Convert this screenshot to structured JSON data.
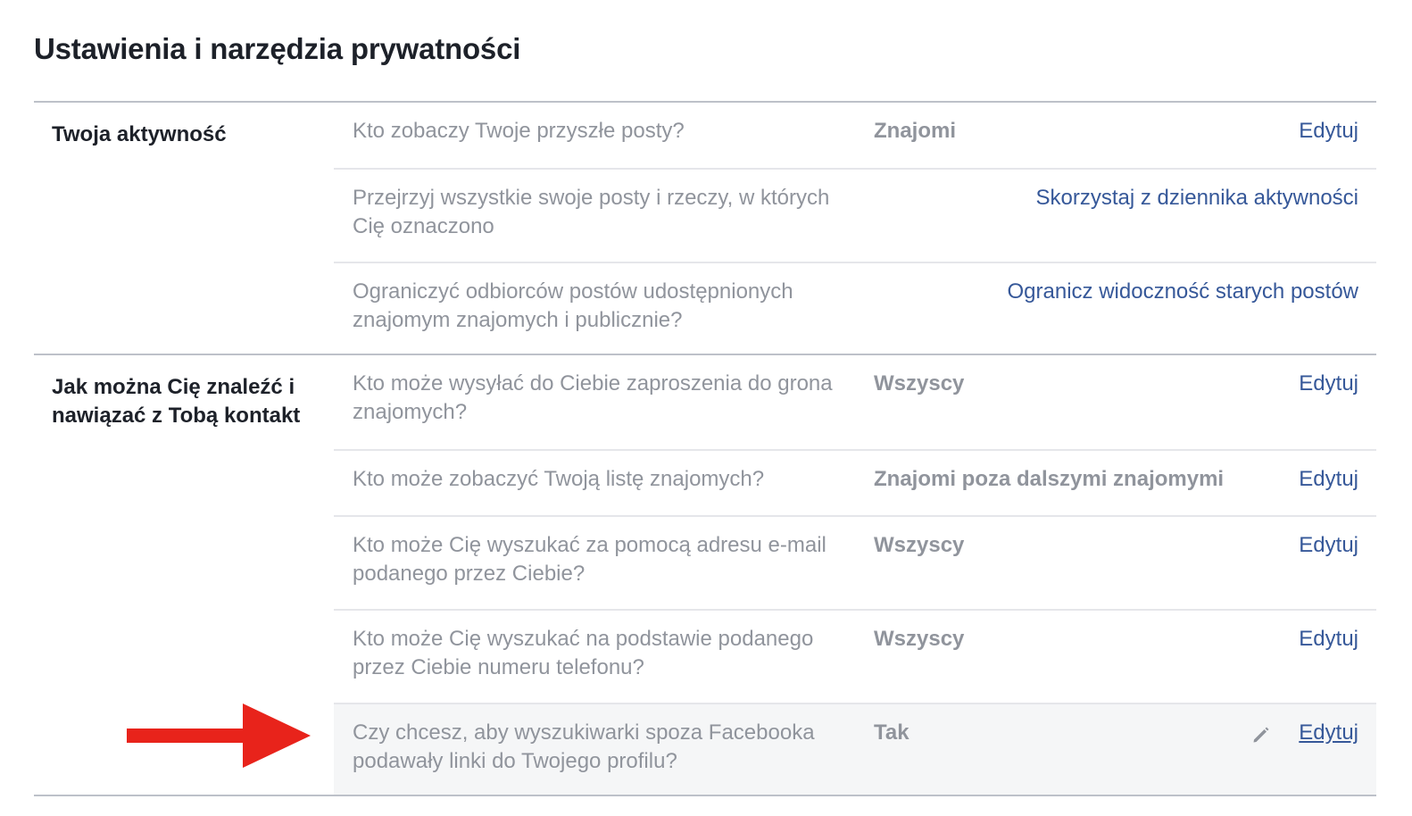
{
  "page_title": "Ustawienia i narzędzia prywatności",
  "sections": [
    {
      "label": "Twoja aktywność",
      "rows": [
        {
          "question": "Kto zobaczy Twoje przyszłe posty?",
          "value": "Znajomi",
          "action": "Edytuj"
        },
        {
          "question": "Przejrzyj wszystkie swoje posty i rzeczy, w których Cię oznaczono",
          "value": "",
          "action": "Skorzystaj z dziennika aktywności"
        },
        {
          "question": "Ograniczyć odbiorców postów udostępnionych znajomym znajomych i publicznie?",
          "value": "",
          "action": "Ogranicz widoczność starych postów"
        }
      ]
    },
    {
      "label": "Jak można Cię znaleźć i nawiązać z Tobą kontakt",
      "rows": [
        {
          "question": "Kto może wysyłać do Ciebie zaproszenia do grona znajomych?",
          "value": "Wszyscy",
          "action": "Edytuj"
        },
        {
          "question": "Kto może zobaczyć Twoją listę znajomych?",
          "value": "Znajomi poza dalszymi znajomymi",
          "action": "Edytuj"
        },
        {
          "question": "Kto może Cię wyszukać za pomocą adresu e-mail podanego przez Ciebie?",
          "value": "Wszyscy",
          "action": "Edytuj"
        },
        {
          "question": "Kto może Cię wyszukać na podstawie podanego przez Ciebie numeru telefonu?",
          "value": "Wszyscy",
          "action": "Edytuj"
        },
        {
          "question": "Czy chcesz, aby wyszukiwarki spoza Facebooka podawały linki do Twojego profilu?",
          "value": "Tak",
          "action": "Edytuj"
        }
      ]
    }
  ],
  "icons": {
    "edit_pencil": "pencil-icon",
    "annotation_arrow": "red-arrow-icon"
  },
  "colors": {
    "link": "#365899",
    "muted_text": "#90949c",
    "title": "#1d2129",
    "arrow": "#e8231b",
    "highlight_row": "#f5f6f7"
  }
}
